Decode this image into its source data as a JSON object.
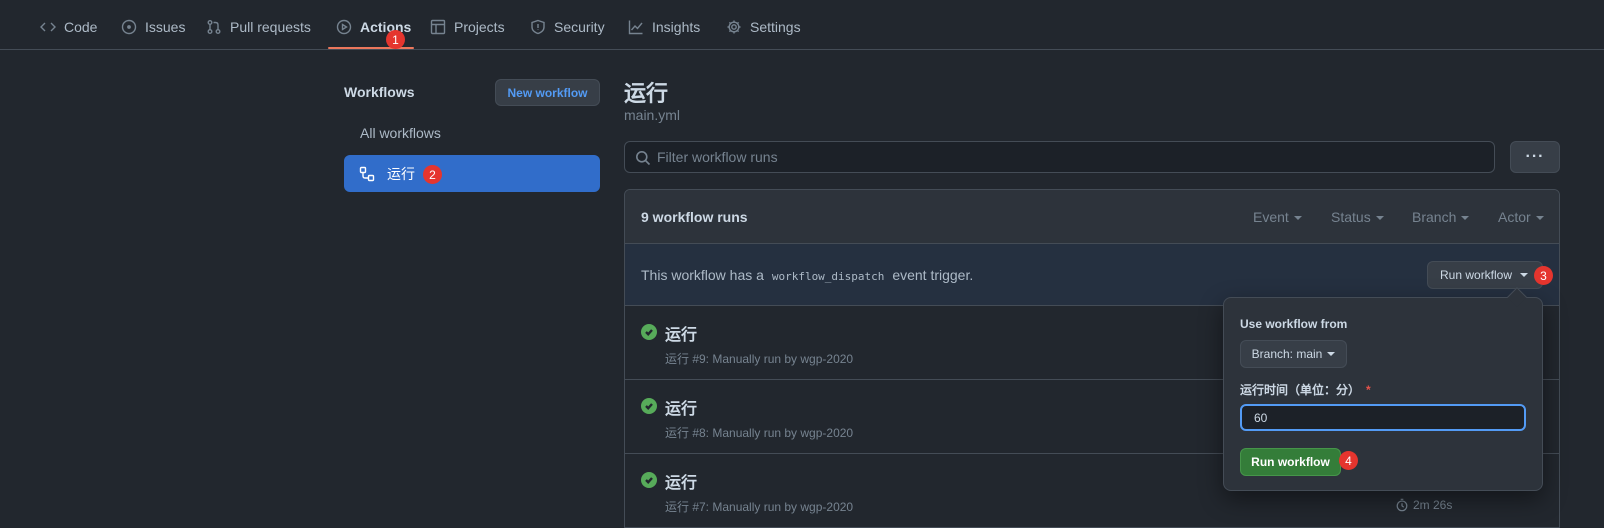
{
  "nav": {
    "items": [
      {
        "label": "Code",
        "icon": "code-icon"
      },
      {
        "label": "Issues",
        "icon": "issue-icon"
      },
      {
        "label": "Pull requests",
        "icon": "pull-request-icon"
      },
      {
        "label": "Actions",
        "icon": "play-icon"
      },
      {
        "label": "Projects",
        "icon": "table-icon"
      },
      {
        "label": "Security",
        "icon": "shield-icon"
      },
      {
        "label": "Insights",
        "icon": "graph-icon"
      },
      {
        "label": "Settings",
        "icon": "gear-icon"
      }
    ],
    "active": "Actions"
  },
  "badges": {
    "b1": "1",
    "b2": "2",
    "b3": "3",
    "b4": "4"
  },
  "sidebar": {
    "title": "Workflows",
    "new_button": "New workflow",
    "all_label": "All workflows",
    "active_item": "运行"
  },
  "main": {
    "title": "运行",
    "file": "main.yml",
    "filter_placeholder": "Filter workflow runs",
    "more_label": "···"
  },
  "runs": {
    "count_label": "9 workflow runs",
    "filters": [
      "Event",
      "Status",
      "Branch",
      "Actor"
    ],
    "dispatch_pre": "This workflow has a",
    "dispatch_code": "workflow_dispatch",
    "dispatch_post": "event trigger.",
    "run_button": "Run workflow",
    "items": [
      {
        "title": "运行",
        "meta": "运行 #9: Manually run by wgp-2020",
        "duration": ""
      },
      {
        "title": "运行",
        "meta": "运行 #8: Manually run by wgp-2020",
        "duration": ""
      },
      {
        "title": "运行",
        "meta": "运行 #7: Manually run by wgp-2020",
        "duration": "2m 26s"
      }
    ]
  },
  "popup": {
    "use_from_label": "Use workflow from",
    "branch_label": "Branch: main",
    "time_label": "运行时间（单位：分）",
    "required_mark": "*",
    "time_value": "60",
    "submit_label": "Run workflow"
  },
  "colors": {
    "background": "#22272e",
    "accent_underline": "#ec775c",
    "badge": "#e5352e",
    "active_blue": "#316dca",
    "success": "#57ab5a",
    "run_green": "#347d39"
  }
}
